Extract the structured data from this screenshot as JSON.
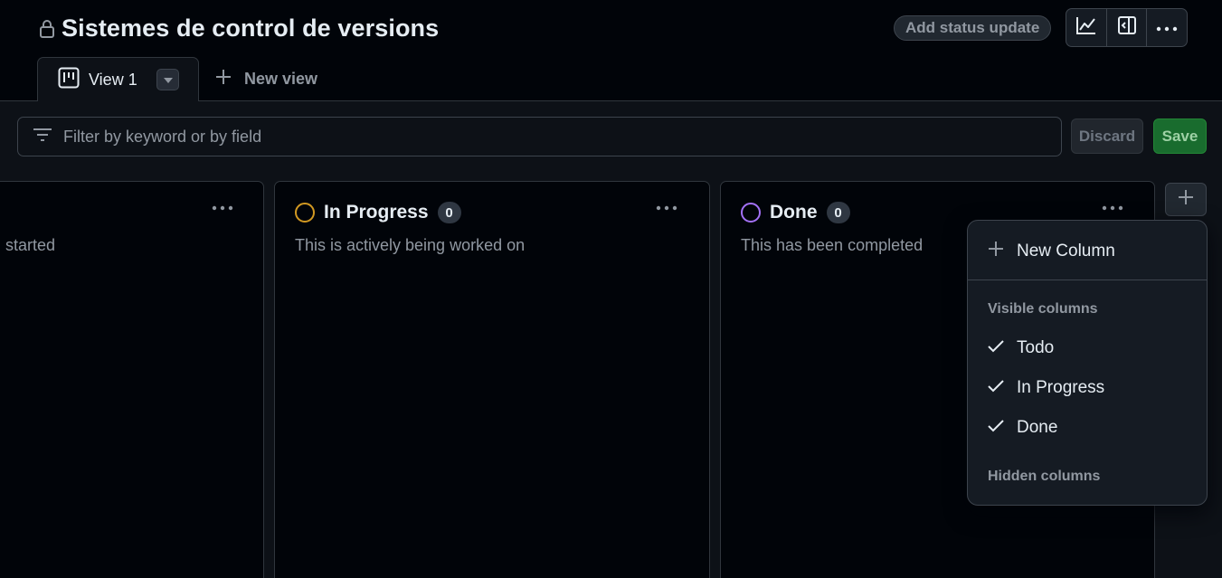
{
  "header": {
    "title": "Sistemes de control de versions",
    "status_button": "Add status update"
  },
  "tabs": [
    {
      "label": "View 1"
    }
  ],
  "new_view_label": "New view",
  "filter": {
    "placeholder": "Filter by keyword or by field",
    "discard_label": "Discard",
    "save_label": "Save"
  },
  "columns": [
    {
      "title": "",
      "count": "",
      "description": "en started"
    },
    {
      "title": "In Progress",
      "count": "0",
      "description": "This is actively being worked on",
      "color": "#d29922"
    },
    {
      "title": "Done",
      "count": "0",
      "description": "This has been completed",
      "color": "#a371f7"
    }
  ],
  "menu": {
    "new_column_label": "New Column",
    "visible_label": "Visible columns",
    "visible_items": [
      "Todo",
      "In Progress",
      "Done"
    ],
    "hidden_label": "Hidden columns"
  },
  "colors": {
    "background": "#010409",
    "panel": "#0d1117",
    "border": "#30363d",
    "save_green": "#196c2e"
  }
}
